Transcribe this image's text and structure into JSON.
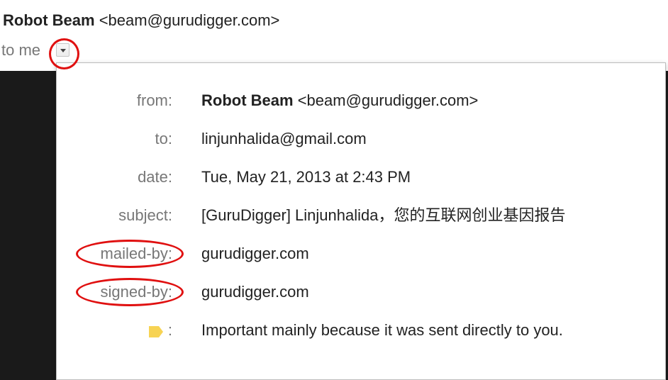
{
  "header": {
    "sender_name": "Robot Beam",
    "sender_email": "<beam@gurudigger.com>",
    "to_text": "to me"
  },
  "details": {
    "from_label": "from:",
    "from_name": "Robot Beam",
    "from_email": "<beam@gurudigger.com>",
    "to_label": "to:",
    "to_value": "linjunhalida@gmail.com",
    "date_label": "date:",
    "date_value": "Tue, May 21, 2013 at 2:43 PM",
    "subject_label": "subject:",
    "subject_value": "[GuruDigger] Linjunhalida，您的互联网创业基因报告",
    "mailed_by_label": "mailed-by:",
    "mailed_by_value": "gurudigger.com",
    "signed_by_label": "signed-by:",
    "signed_by_value": "gurudigger.com",
    "importance_colon": ":",
    "importance_value": "Important mainly because it was sent directly to you."
  },
  "icons": {
    "dropdown": "chevron-down-icon",
    "importance": "importance-marker-icon"
  },
  "colors": {
    "annotation": "#e01010",
    "importance_marker": "#f7d353",
    "label_gray": "#777777"
  }
}
